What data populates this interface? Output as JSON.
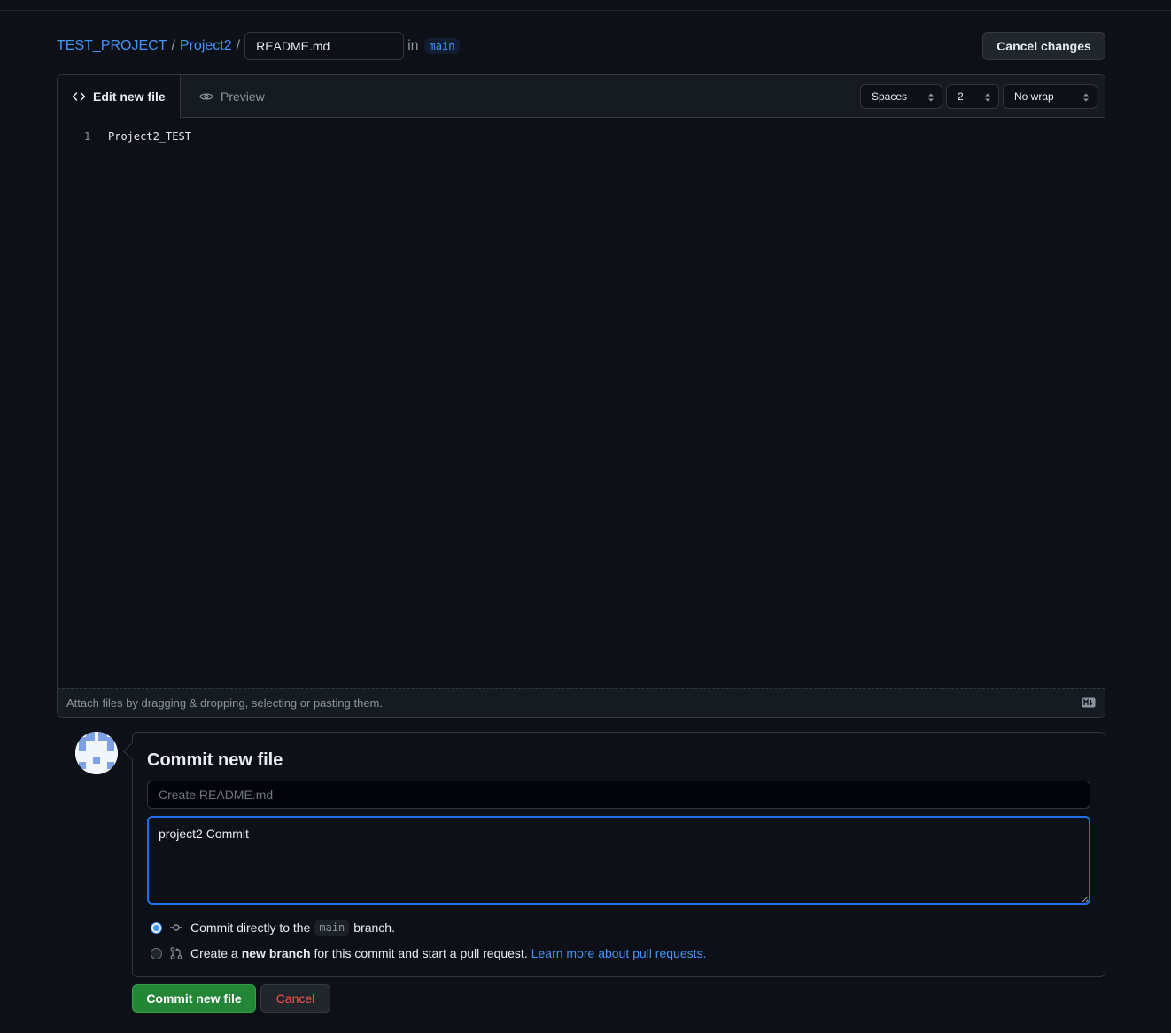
{
  "breadcrumb": {
    "owner": "TEST_PROJECT",
    "repo": "Project2",
    "separator": "/",
    "filename_value": "README.md",
    "in_label": "in",
    "branch": "main"
  },
  "header": {
    "cancel_changes_label": "Cancel changes"
  },
  "editor": {
    "tabs": [
      {
        "label": "Edit new file",
        "icon": "code-icon",
        "active": true
      },
      {
        "label": "Preview",
        "icon": "eye-icon",
        "active": false
      }
    ],
    "indent_mode": "Spaces",
    "indent_size": "2",
    "wrap_mode": "No wrap",
    "lines": [
      {
        "number": "1",
        "text": "Project2_TEST"
      }
    ],
    "footer_text": "Attach files by dragging & dropping, selecting or pasting them.",
    "footer_icon": "markdown-icon"
  },
  "commit": {
    "title": "Commit new file",
    "summary_placeholder": "Create README.md",
    "summary_value": "",
    "description_value": "project2 Commit",
    "option_direct": {
      "prefix": "Commit directly to the",
      "branch": "main",
      "suffix": "branch.",
      "selected": true,
      "icon": "git-commit-icon"
    },
    "option_branch": {
      "prefix": "Create a",
      "bold": "new branch",
      "suffix": "for this commit and start a pull request.",
      "link": "Learn more about pull requests.",
      "selected": false,
      "icon": "git-pull-request-icon"
    },
    "commit_button_label": "Commit new file",
    "cancel_button_label": "Cancel"
  },
  "colors": {
    "background": "#0d1117",
    "link": "#4493f8",
    "primary_button": "#238636",
    "danger_text": "#f85149",
    "focus_border": "#1f6feb"
  }
}
